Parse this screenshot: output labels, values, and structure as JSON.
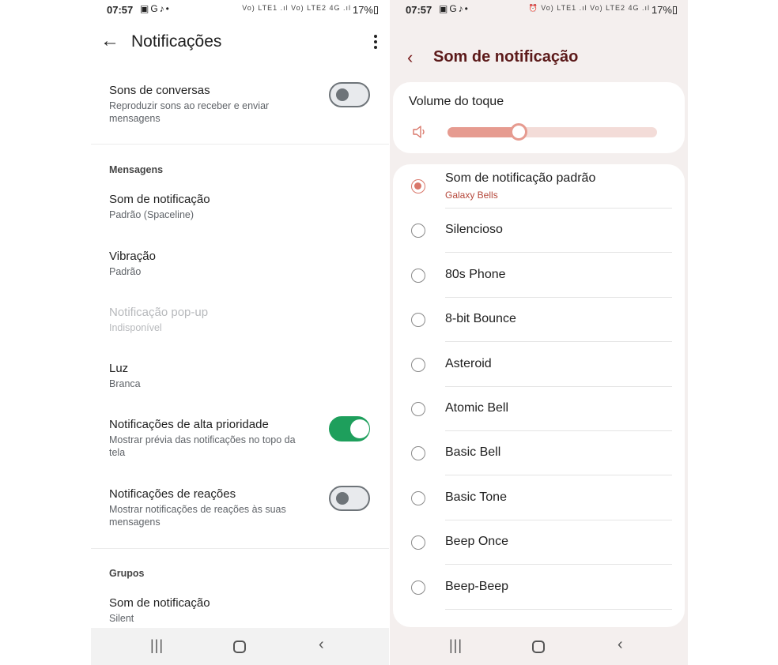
{
  "left": {
    "status": {
      "time": "07:57",
      "icons": "▣G♪•",
      "signal": "Vo) LTE1 .ıl Vo) LTE2 4G .ıl",
      "battery": "17%"
    },
    "appbar": {
      "title": "Notificações"
    },
    "conversation_sounds": {
      "title": "Sons de conversas",
      "sub": "Reproduzir sons ao receber e enviar mensagens",
      "on": false
    },
    "messages_header": "Mensagens",
    "msg_sound": {
      "title": "Som de notificação",
      "sub": "Padrão (Spaceline)"
    },
    "vibration": {
      "title": "Vibração",
      "sub": "Padrão"
    },
    "popup": {
      "title": "Notificação pop-up",
      "sub": "Indisponível"
    },
    "light": {
      "title": "Luz",
      "sub": "Branca"
    },
    "high_priority": {
      "title": "Notificações de alta prioridade",
      "sub": "Mostrar prévia das notificações no topo da tela",
      "on": true
    },
    "reactions": {
      "title": "Notificações de reações",
      "sub": "Mostrar notificações de reações às suas mensagens",
      "on": false
    },
    "groups_header": "Grupos",
    "group_sound": {
      "title": "Som de notificação",
      "sub": "Silent"
    }
  },
  "right": {
    "status": {
      "time": "07:57",
      "icons": "▣G♪•",
      "signal": "⏰ Vo) LTE1 .ıl Vo) LTE2 4G .ıl",
      "battery": "17%"
    },
    "title": "Som de notificação",
    "volume_label": "Volume do toque",
    "volume_level": 0.34,
    "options": [
      {
        "label": "Som de notificação padrão",
        "sub": "Galaxy Bells",
        "selected": true
      },
      {
        "label": "Silencioso"
      },
      {
        "label": "80s Phone"
      },
      {
        "label": "8-bit Bounce"
      },
      {
        "label": "Asteroid"
      },
      {
        "label": "Atomic Bell"
      },
      {
        "label": "Basic Bell"
      },
      {
        "label": "Basic Tone"
      },
      {
        "label": "Beep Once"
      },
      {
        "label": "Beep-Beep"
      }
    ]
  },
  "colors": {
    "accent_green": "#1e9f5c",
    "samsung_accent": "#d9776a",
    "samsung_title": "#5c1a1a"
  }
}
